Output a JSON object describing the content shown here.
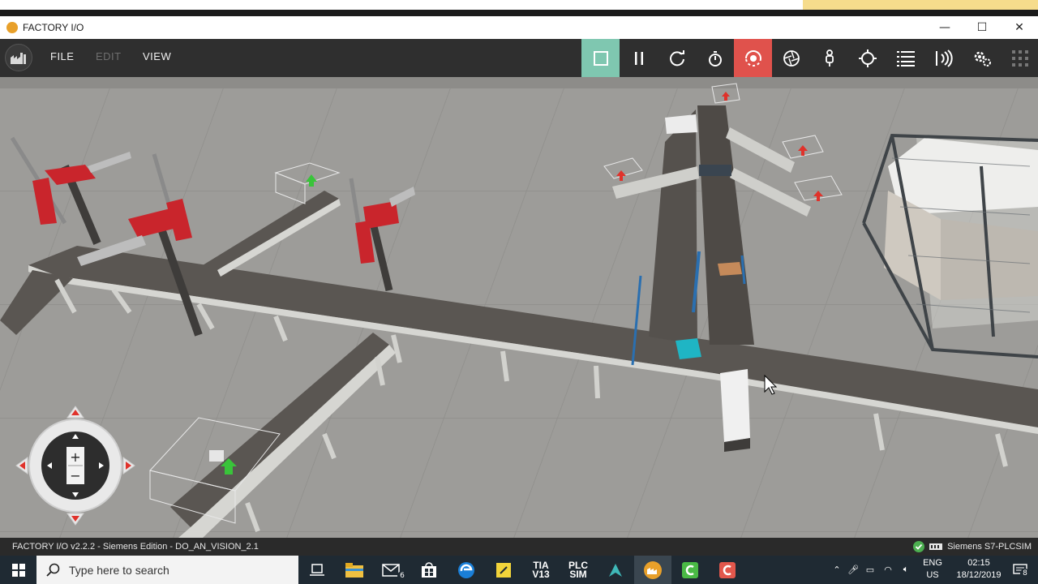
{
  "window": {
    "title": "FACTORY I/O",
    "controls": {
      "minimize": "—",
      "maximize": "☐",
      "close": "✕"
    }
  },
  "menu": {
    "items": [
      {
        "label": "FILE",
        "enabled": true
      },
      {
        "label": "EDIT",
        "enabled": false
      },
      {
        "label": "VIEW",
        "enabled": true
      }
    ]
  },
  "toolbar": {
    "tools": [
      {
        "name": "stop",
        "icon": "stop-square-icon",
        "color": "#7fc7b0"
      },
      {
        "name": "pause",
        "icon": "pause-icon"
      },
      {
        "name": "reset",
        "icon": "reset-icon"
      },
      {
        "name": "timer",
        "icon": "stopwatch-icon"
      },
      {
        "name": "camera-orbit",
        "icon": "orbit-camera-icon",
        "color": "#e0524c"
      },
      {
        "name": "fly-camera",
        "icon": "aperture-icon"
      },
      {
        "name": "first-person",
        "icon": "person-icon"
      },
      {
        "name": "target",
        "icon": "crosshair-icon"
      },
      {
        "name": "tags",
        "icon": "list-icon"
      },
      {
        "name": "sensors",
        "icon": "signal-icon"
      },
      {
        "name": "drivers",
        "icon": "cogs-icon"
      },
      {
        "name": "grid",
        "icon": "grid-icon"
      }
    ]
  },
  "status": {
    "left_text": "FACTORY I/O v2.2.2 - Siemens Edition - DO_AN_VISION_2.1",
    "driver": "Siemens S7-PLCSIM",
    "ok_color": "#4caf50"
  },
  "taskbar": {
    "search_placeholder": "Type here to search",
    "mail_badge": "6",
    "tia_label_top": "TIA",
    "tia_label_bottom": "V13",
    "plc_label_top": "PLC",
    "plc_label_bottom": "SIM",
    "lang_top": "ENG",
    "lang_bottom": "US",
    "time": "02:15",
    "date": "18/12/2019",
    "notification_count": "8"
  },
  "navigation": {
    "zoom_in": "+",
    "zoom_out": "−"
  }
}
